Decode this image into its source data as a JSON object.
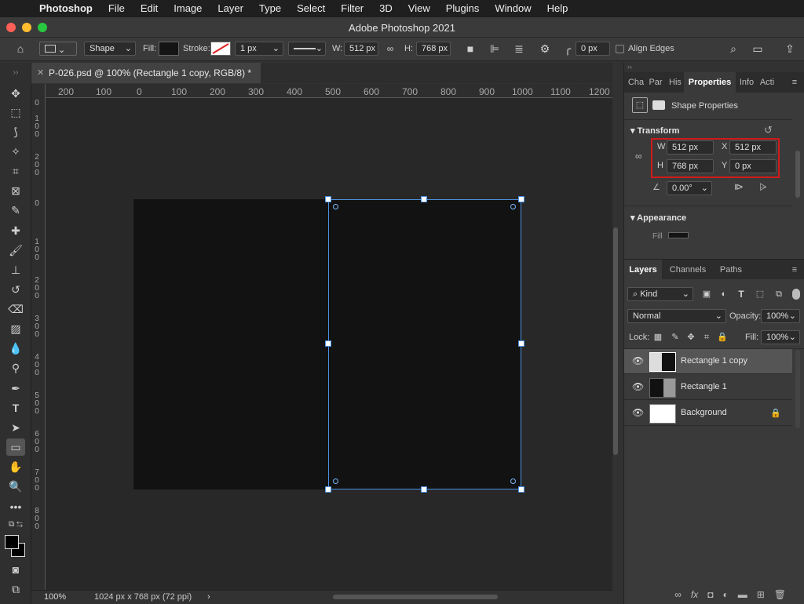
{
  "menubar": {
    "app": "Photoshop",
    "items": [
      "File",
      "Edit",
      "Image",
      "Layer",
      "Type",
      "Select",
      "Filter",
      "3D",
      "View",
      "Plugins",
      "Window",
      "Help"
    ]
  },
  "window": {
    "title": "Adobe Photoshop 2021"
  },
  "options": {
    "mode": "Shape",
    "fill_label": "Fill:",
    "stroke_label": "Stroke:",
    "stroke_width": "1 px",
    "w_label": "W:",
    "w_value": "512 px",
    "h_label": "H:",
    "h_value": "768 px",
    "corner_radius": "0 px",
    "align_edges": "Align Edges",
    "fill_color": "#141414"
  },
  "document": {
    "tab": "P-026.psd @ 100% (Rectangle 1 copy, RGB/8) *",
    "zoom": "100%",
    "size_info": "1024 px x 768 px (72 ppi)"
  },
  "ruler": {
    "h": [
      "200",
      "100",
      "0",
      "100",
      "200",
      "300",
      "400",
      "500",
      "600",
      "700",
      "800",
      "900",
      "1000",
      "1100",
      "1200"
    ],
    "v": [
      "0",
      "100",
      "200",
      "0",
      "100",
      "200",
      "300",
      "400",
      "500",
      "600",
      "700",
      "800"
    ]
  },
  "properties": {
    "tabs": [
      "Cha",
      "Par",
      "His",
      "Properties",
      "Info",
      "Acti"
    ],
    "header": "Shape Properties",
    "transform": "Transform",
    "w_label": "W",
    "w": "512 px",
    "x_label": "X",
    "x": "512 px",
    "h_label": "H",
    "h": "768 px",
    "y_label": "Y",
    "y": "0 px",
    "angle": "0.00°",
    "appearance": "Appearance",
    "fill_label": "Fill"
  },
  "layers_panel": {
    "tabs": [
      "Layers",
      "Channels",
      "Paths"
    ],
    "kind": "Kind",
    "blend": "Normal",
    "opacity_label": "Opacity:",
    "opacity": "100%",
    "lock_label": "Lock:",
    "fill_label": "Fill:",
    "fill": "100%",
    "layers": [
      {
        "name": "Rectangle 1 copy"
      },
      {
        "name": "Rectangle 1"
      },
      {
        "name": "Background"
      }
    ]
  },
  "colors": {
    "shape_fill": "#121212",
    "selection": "#4a90e2",
    "highlight_box": "#d11a1a"
  }
}
